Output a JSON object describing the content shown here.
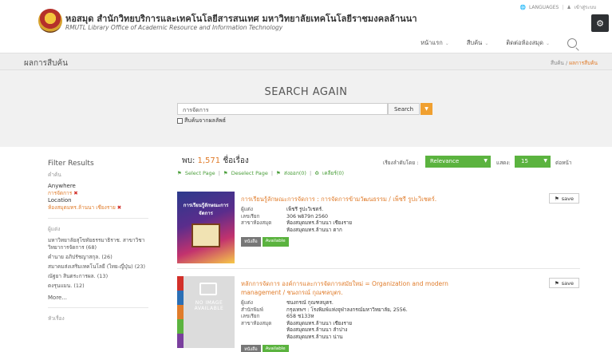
{
  "header": {
    "title": "หอสมุด สำนักวิทยบริการและเทคโนโลยีสารสนเทศ มหาวิทยาลัยเทคโนโลยีราชมงคลล้านนา",
    "subtitle": "RMUTL Library Office of Academic Resource and Information Technology",
    "languages_label": "LANGUAGES",
    "login_label": "เข้าสู่ระบบ",
    "nav": [
      "หน้าแรก",
      "สืบค้น",
      "ติดต่อห้องสมุด"
    ]
  },
  "titlebar": {
    "title": "ผลการสืบค้น",
    "breadcrumb_root": "สืบค้น",
    "breadcrumb_sep": "/",
    "breadcrumb_current": "ผลการสืบค้น"
  },
  "search": {
    "heading": "SEARCH AGAIN",
    "query": "การจัดการ",
    "button_label": "Search",
    "within_label": "สืบค้นจากผลลัพธ์"
  },
  "sidebar": {
    "title": "Filter Results",
    "current_heading": "คำค้น",
    "selected": [
      {
        "label": "Anywhere",
        "value": "การจัดการ"
      },
      {
        "label": "Location",
        "value": "ห้องสมุดมทร.ล้านนา เชียงราย"
      }
    ],
    "author_heading": "ผู้แต่ง",
    "authors": [
      "มหาวิทยาลัยสุโขทัยธรรมาธิราช. สาขาวิชาวิทยาการจัดการ (68)",
      "คำนาย อภิปรัชญาสกุล. (26)",
      "สมาคมส่งเสริมเทคโนโลยี (ไทย-ญี่ปุ่น) (23)",
      "ณัฐยา สินตระการผล. (13)",
      "ดงรุนแมน. (12)"
    ],
    "more_label": "More...",
    "subject_heading": "หัวเรื่อง"
  },
  "results": {
    "found_label": "พบ:",
    "count": "1,571",
    "unit": "ชื่อเรื่อง",
    "bulk": [
      "Select Page",
      "Deselect Page",
      "ส่งออก(0)",
      "เคลียร์(0)"
    ],
    "sort_label": "เรียงลำดับโดย :",
    "sort_value": "Relevance",
    "show_label": "แสดง:",
    "show_value": "15",
    "per_page_label": "ต่อหน้า"
  },
  "records": [
    {
      "cover_title": "การเรียนรู้ลักษณะการจัดการ",
      "title": "การเรียนรู้ลักษณะการจัดการ : การจัดการข้ามวัฒนธรรม / เพ็ชรี รูปะวิเชตร์.",
      "meta": [
        {
          "k": "ผู้แต่ง",
          "v": "เพ็ชรี รูปะวิเชตร์."
        },
        {
          "k": "เลขเรียก",
          "v": "306 พ879ก 2560"
        },
        {
          "k": "สาขาห้องสมุด",
          "v": "ห้องสมุดมทร.ล้านนา เชียงราย"
        },
        {
          "k": "",
          "v": "ห้องสมุดมทร.ล้านนา ตาก"
        }
      ],
      "type": "หนังสือ",
      "availability": "Available",
      "save_label": "save"
    },
    {
      "cover_title": "NO IMAGE AVAILABLE",
      "title": "หลักการจัดการ องค์การและการจัดการสมัยใหม่ = Organization and modern management / ชนงกรณ์ กุณฑลบุตร.",
      "meta": [
        {
          "k": "ผู้แต่ง",
          "v": "ชนงกรณ์ กุณฑลบุตร."
        },
        {
          "k": "สำนักพิมพ์",
          "v": "กรุงเทพฯ : โรงพิมพ์แห่งจุฬาลงกรณ์มหาวิทยาลัย, 2556."
        },
        {
          "k": "เลขเรียก",
          "v": "658 ช133ห"
        },
        {
          "k": "สาขาห้องสมุด",
          "v": "ห้องสมุดมทร.ล้านนา เชียงราย"
        },
        {
          "k": "",
          "v": "ห้องสมุดมทร.ล้านนา ลำปาง"
        },
        {
          "k": "",
          "v": "ห้องสมุดมทร.ล้านนา น่าน"
        }
      ],
      "type": "หนังสือ",
      "availability": "Available",
      "save_label": "save"
    }
  ],
  "colors": {
    "accent": "#e07c2b",
    "green": "#5bb33f",
    "remove": "#d2302a"
  }
}
